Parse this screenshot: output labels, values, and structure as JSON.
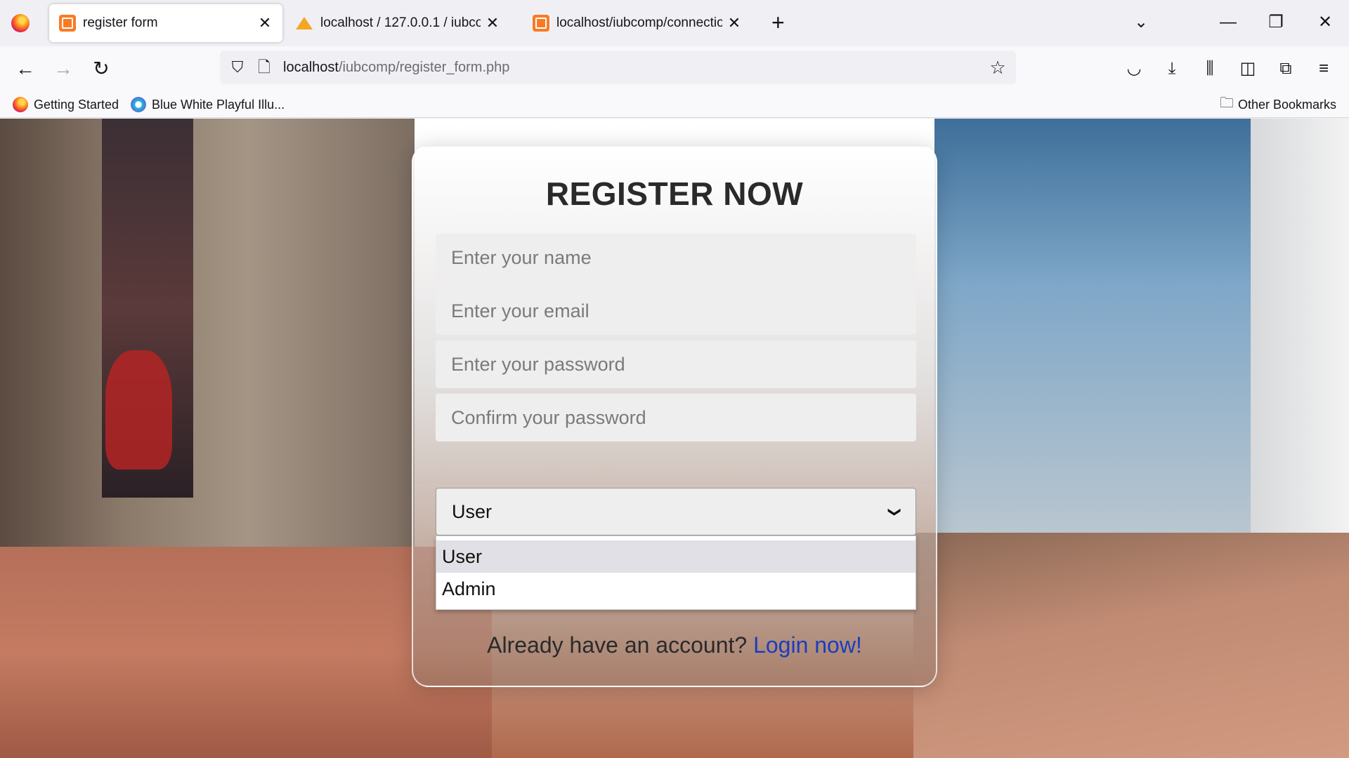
{
  "browser": {
    "tabs": [
      {
        "title": "register form",
        "active": true,
        "favicon": "xampp-icon"
      },
      {
        "title": "localhost / 127.0.0.1 / iubcomp",
        "active": false,
        "favicon": "phpmyadmin-icon"
      },
      {
        "title": "localhost/iubcomp/connection.p",
        "active": false,
        "favicon": "xampp-icon"
      }
    ],
    "url_host": "localhost",
    "url_path": "/iubcomp/register_form.php",
    "bookmarks": [
      {
        "label": "Getting Started",
        "icon": "firefox-icon"
      },
      {
        "label": "Blue White Playful Illu...",
        "icon": "canva-icon"
      }
    ],
    "other_bookmarks": "Other Bookmarks",
    "icons": {
      "close": "✕",
      "plus": "+",
      "chevron_down": "⌄",
      "minimize": "—",
      "restore": "❐",
      "window_close": "✕",
      "back": "←",
      "forward": "→",
      "reload": "↻",
      "shield": "⛉",
      "page": "🗋",
      "star": "☆",
      "pocket": "◡",
      "download": "⤓",
      "library": "⫼",
      "sidebar": "◫",
      "extensions": "⧉",
      "menu": "≡",
      "folder": "🗀"
    }
  },
  "form": {
    "title": "REGISTER NOW",
    "name_placeholder": "Enter your name",
    "email_placeholder": "Enter your email",
    "password_placeholder": "Enter your password",
    "confirm_placeholder": "Confirm your password",
    "role_selected": "User",
    "role_options": [
      "User",
      "Admin"
    ],
    "login_prompt": "Already have an account?",
    "login_link": "Login now!"
  },
  "colors": {
    "link": "#1a3dbf",
    "title": "#2a2a2a",
    "field_bg": "#eeeeee"
  }
}
